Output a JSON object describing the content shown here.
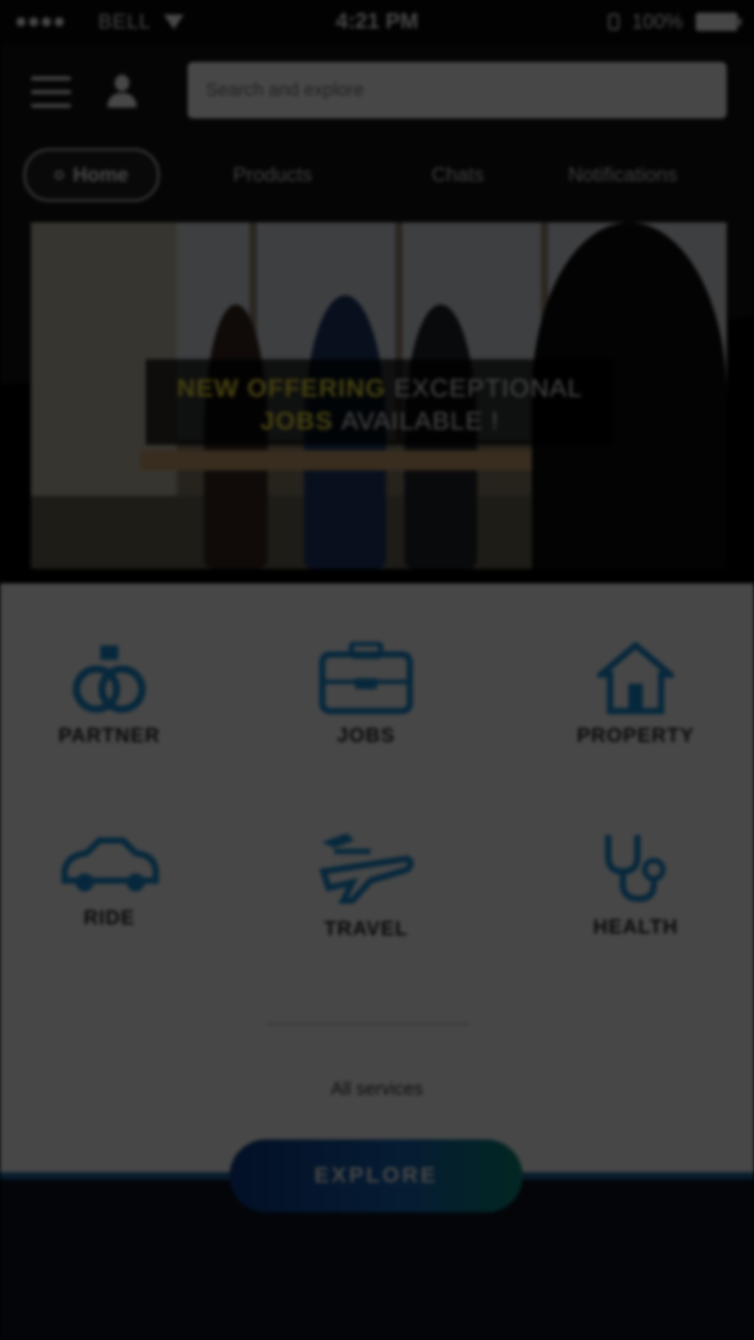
{
  "status_bar": {
    "carrier": "BELL",
    "time": "4:21 PM",
    "battery": "100%"
  },
  "header": {
    "search_placeholder": "Search and explore",
    "tabs": [
      {
        "label": "Home",
        "active": true
      },
      {
        "label": "Products",
        "active": false
      },
      {
        "label": "Chats",
        "active": false
      },
      {
        "label": "Notifications",
        "active": false
      }
    ]
  },
  "hero": {
    "tag_highlight_1": "NEW OFFERING",
    "tag_text_1": "EXCEPTIONAL",
    "tag_highlight_2": "JOBS",
    "tag_text_2": "AVAILABLE !"
  },
  "services": [
    {
      "label": "PARTNER",
      "icon": "rings-icon"
    },
    {
      "label": "JOBS",
      "icon": "briefcase-icon"
    },
    {
      "label": "PROPERTY",
      "icon": "house-icon"
    },
    {
      "label": "RIDE",
      "icon": "car-icon"
    },
    {
      "label": "TRAVEL",
      "icon": "airplane-icon"
    },
    {
      "label": "HEALTH",
      "icon": "stethoscope-icon"
    }
  ],
  "all_services": "All services",
  "explore_button": "EXPLORE",
  "colors": {
    "icon_blue": "#1a8fd6",
    "highlight_yellow": "#f4e13a"
  }
}
